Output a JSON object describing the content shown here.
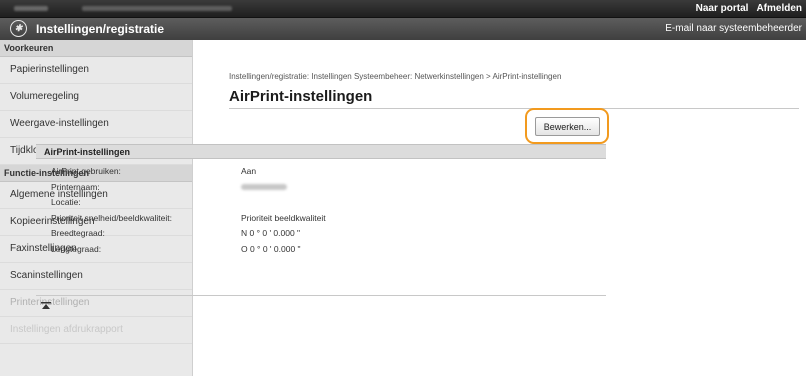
{
  "topbar": {
    "portal_link": "Naar portal",
    "logout_link": "Afmelden"
  },
  "header": {
    "title": "Instellingen/registratie",
    "mail_link": "E-mail naar systeembeheerder"
  },
  "sidebar": {
    "sections": [
      {
        "label": "Voorkeuren",
        "items": [
          "Papierinstellingen",
          "Volumeregeling",
          "Weergave-instellingen",
          "Tijdklokinstellingen"
        ]
      },
      {
        "label": "Functie-instellingen",
        "items": [
          "Algemene instellingen",
          "Kopieerinstellingen",
          "Faxinstellingen",
          "Scaninstellingen",
          "Printerinstellingen",
          "Instellingen afdrukrapport"
        ]
      }
    ]
  },
  "main": {
    "breadcrumb": "Instellingen/registratie: Instellingen Systeembeheer: Netwerkinstellingen > AirPrint-instellingen",
    "title": "AirPrint-instellingen",
    "edit_button": "Bewerken...",
    "section_title": "AirPrint-instellingen",
    "rows": [
      {
        "label": "AirPrint gebruiken:",
        "value": "Aan"
      },
      {
        "label": "Printernaam:",
        "value": ""
      },
      {
        "label": "Locatie:",
        "value": ""
      },
      {
        "label": "Prioriteit snelheid/beeldkwaliteit:",
        "value": "Prioriteit beeldkwaliteit"
      },
      {
        "label": "Breedtegraad:",
        "value": "N 0 ° 0 ' 0.000 \""
      },
      {
        "label": "Lengtegraad:",
        "value": "O 0 ° 0 ' 0.000 \""
      }
    ],
    "to_top_icon": "back-to-top-icon"
  },
  "colors": {
    "highlight": "#f29a1e",
    "topbar": "#2a2a2a",
    "header": "#4e4e4e",
    "sidebar": "#e9e9e9"
  }
}
